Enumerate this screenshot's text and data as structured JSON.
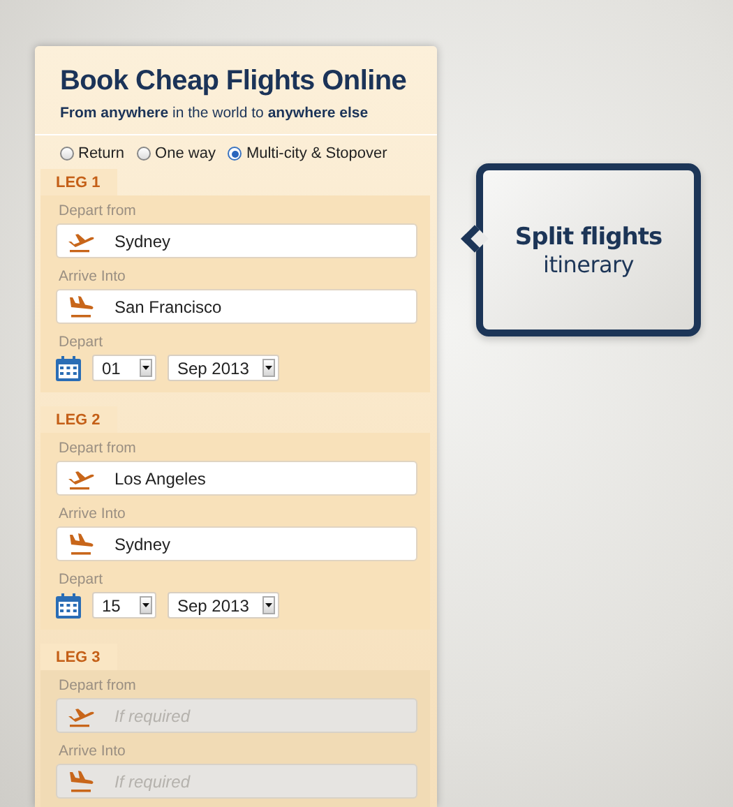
{
  "form": {
    "title": "Book Cheap Flights Online",
    "subtitle": "**From anywhere** in the world to **anywhere else**",
    "trip_types": [
      {
        "label": "Return",
        "selected": false
      },
      {
        "label": "One way",
        "selected": false
      },
      {
        "label": "Multi-city & Stopover",
        "selected": true
      }
    ],
    "legs": [
      {
        "label": "LEG 1",
        "disabled": false,
        "fields": [
          {
            "kind": "depart",
            "label": "Depart from",
            "value": "Sydney"
          },
          {
            "kind": "arrive",
            "label": "Arrive Into",
            "value": "San Francisco"
          }
        ],
        "date": {
          "label": "Depart",
          "day": "01",
          "month": "Sep 2013"
        }
      },
      {
        "label": "LEG 2",
        "disabled": false,
        "fields": [
          {
            "kind": "depart",
            "label": "Depart from",
            "value": "Los Angeles"
          },
          {
            "kind": "arrive",
            "label": "Arrive Into",
            "value": "Sydney"
          }
        ],
        "date": {
          "label": "Depart",
          "day": "15",
          "month": "Sep 2013"
        }
      },
      {
        "label": "LEG 3",
        "disabled": true,
        "fields": [
          {
            "kind": "depart",
            "label": "Depart from",
            "placeholder": "If required"
          },
          {
            "kind": "arrive",
            "label": "Arrive Into",
            "placeholder": "If required"
          }
        ]
      }
    ]
  },
  "callout": {
    "title": "Split flights",
    "text": "itinerary"
  }
}
